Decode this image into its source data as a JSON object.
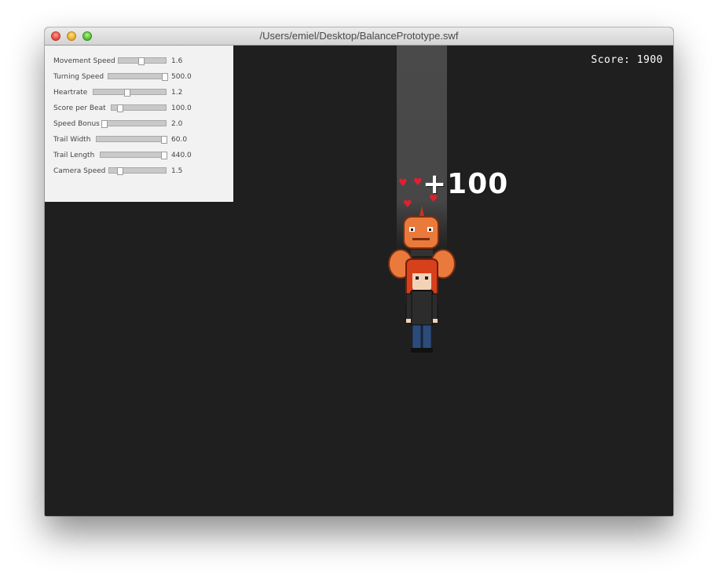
{
  "window": {
    "title": "/Users/emiel/Desktop/BalancePrototype.swf"
  },
  "hud": {
    "score_text": "Score: 1900",
    "bonus_text": "+100"
  },
  "settings": [
    {
      "label": "Movement Speed",
      "value": "1.6",
      "level": 0.48
    },
    {
      "label": "Turning Speed",
      "value": "500.0",
      "level": 0.98
    },
    {
      "label": "Heartrate",
      "value": "1.2",
      "level": 0.47
    },
    {
      "label": "Score per Beat",
      "value": "100.0",
      "level": 0.16
    },
    {
      "label": "Speed Bonus",
      "value": "2.0",
      "level": 0.02
    },
    {
      "label": "Trail Width",
      "value": "60.0",
      "level": 0.98
    },
    {
      "label": "Trail Length",
      "value": "440.0",
      "level": 0.98
    },
    {
      "label": "Camera Speed",
      "value": "1.5",
      "level": 0.2
    }
  ],
  "colors": {
    "stage_bg": "#1f1f1f",
    "panel_bg": "#f2f2f2",
    "beam": "#4a4a4a",
    "heart": "#e02030"
  }
}
